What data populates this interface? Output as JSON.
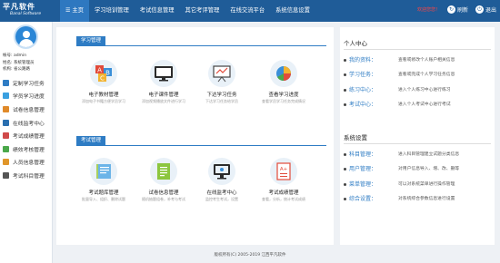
{
  "app": {
    "logo_cn": "平凡软件",
    "logo_en": "Banal Software",
    "welcome": "欢迎您您！",
    "refresh": "刷新",
    "logout": "退出"
  },
  "nav": [
    {
      "label": "主页"
    },
    {
      "label": "学习培训管理"
    },
    {
      "label": "考试信息管理"
    },
    {
      "label": "其它考评管理"
    },
    {
      "label": "在线交流平台"
    },
    {
      "label": "系统信息设置"
    }
  ],
  "user": {
    "account": "帐号: admin",
    "name": "姓名: 系统管理员",
    "unit": "机构: 省公路路"
  },
  "sidebar": {
    "items": [
      {
        "label": "定制学习任务",
        "color": "#2e7cc4"
      },
      {
        "label": "学员学习进度",
        "color": "#3aa0e0"
      },
      {
        "label": "试卷信息管理",
        "color": "#e08a2a"
      },
      {
        "label": "在线监考中心",
        "color": "#2a6fb0"
      },
      {
        "label": "考试成绩管理",
        "color": "#d04a4a"
      },
      {
        "label": "绩效考核管理",
        "color": "#4aa84a"
      },
      {
        "label": "人员信息管理",
        "color": "#e0962a"
      },
      {
        "label": "考试科目管理",
        "color": "#555555"
      }
    ]
  },
  "main": {
    "study_title": "学习管理",
    "exam_title": "考试管理",
    "study_tiles": [
      {
        "label": "电子教材管理",
        "sub": "添加电子书籍方便学员学习"
      },
      {
        "label": "电子课件管理",
        "sub": "添加视频播放文件进行学习"
      },
      {
        "label": "下达学习任务",
        "sub": "下达学习任务给学员"
      },
      {
        "label": "查看学习进度",
        "sub": "查看学员学习任务完成情况"
      }
    ],
    "exam_tiles": [
      {
        "label": "考试题库管理",
        "sub": "批量导入、组织、删除试题"
      },
      {
        "label": "试卷信息管理",
        "sub": "随机抽题组卷，补考与考试"
      },
      {
        "label": "在线监考中心",
        "sub": "监控考生考试，设置"
      },
      {
        "label": "考试成绩管理",
        "sub": "查看，分析，统计考试成绩"
      }
    ]
  },
  "right": {
    "personal_title": "个人中心",
    "personal": [
      {
        "key": "我的资料：",
        "value": "查看或修改个人账户相关信息"
      },
      {
        "key": "学习任务：",
        "value": "查看或完成个人学习任务信息"
      },
      {
        "key": "练习中心：",
        "value": "进入个人练习中心进行练习"
      },
      {
        "key": "考试中心：",
        "value": "进入个人考试中心进行考试"
      }
    ],
    "system_title": "系统设置",
    "system": [
      {
        "key": "科目管理：",
        "value": "进入科目管理建立试题分类信息"
      },
      {
        "key": "用户管理：",
        "value": "对用户信息导入、增、改、删等"
      },
      {
        "key": "菜单管理：",
        "value": "可以对系统菜单进行操作管理"
      },
      {
        "key": "综合设置：",
        "value": "对系统综合参数信息进行设置"
      }
    ]
  },
  "footer": "版权所有(C) 2005-2019 江西平凡软件",
  "colors": {
    "topbar": "#1f5c98",
    "accent": "#2e7cc4"
  }
}
